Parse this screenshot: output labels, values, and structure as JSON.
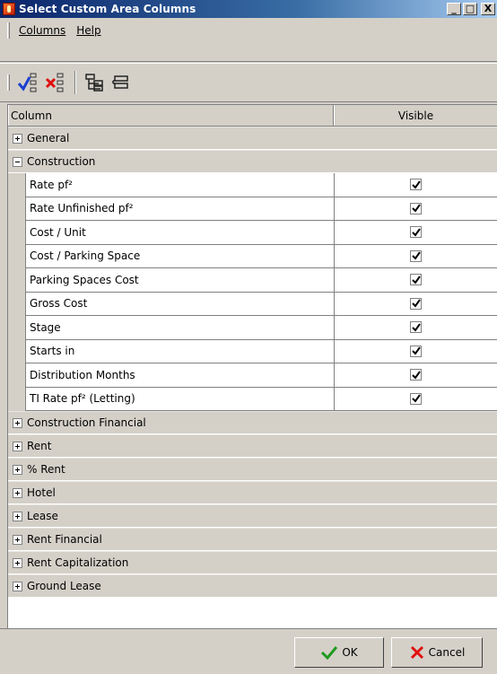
{
  "window": {
    "title": "Select Custom Area Columns",
    "min_label": "_",
    "max_label": "□",
    "close_label": "X"
  },
  "menu": [
    {
      "label": "Columns"
    },
    {
      "label": "Help"
    }
  ],
  "toolbar": [
    {
      "icon": "check-all-icon"
    },
    {
      "icon": "uncheck-all-icon"
    },
    {
      "icon": "expand-all-icon"
    },
    {
      "icon": "collapse-all-icon"
    }
  ],
  "grid": {
    "headers": {
      "column": "Column",
      "visible": "Visible"
    },
    "groups": [
      {
        "label": "General",
        "expanded": false
      },
      {
        "label": "Construction",
        "expanded": true,
        "items": [
          {
            "label": "Rate pf²",
            "visible": true
          },
          {
            "label": "Rate Unfinished pf²",
            "visible": true
          },
          {
            "label": "Cost / Unit",
            "visible": true
          },
          {
            "label": "Cost / Parking Space",
            "visible": true
          },
          {
            "label": "Parking Spaces Cost",
            "visible": true
          },
          {
            "label": "Gross Cost",
            "visible": true
          },
          {
            "label": "Stage",
            "visible": true
          },
          {
            "label": "Starts in",
            "visible": true
          },
          {
            "label": "Distribution Months",
            "visible": true
          },
          {
            "label": "TI Rate pf² (Letting)",
            "visible": true
          }
        ]
      },
      {
        "label": "Construction Financial",
        "expanded": false
      },
      {
        "label": "Rent",
        "expanded": false
      },
      {
        "label": "% Rent",
        "expanded": false
      },
      {
        "label": "Hotel",
        "expanded": false
      },
      {
        "label": "Lease",
        "expanded": false
      },
      {
        "label": "Rent Financial",
        "expanded": false
      },
      {
        "label": "Rent Capitalization",
        "expanded": false
      },
      {
        "label": "Ground Lease",
        "expanded": false
      }
    ]
  },
  "buttons": {
    "ok": "OK",
    "cancel": "Cancel"
  },
  "colors": {
    "title_start": "#0a246a",
    "title_end": "#a6caf0",
    "face": "#d4d0c8",
    "ok_green": "#1f9a1f",
    "cancel_red": "#e01010"
  }
}
